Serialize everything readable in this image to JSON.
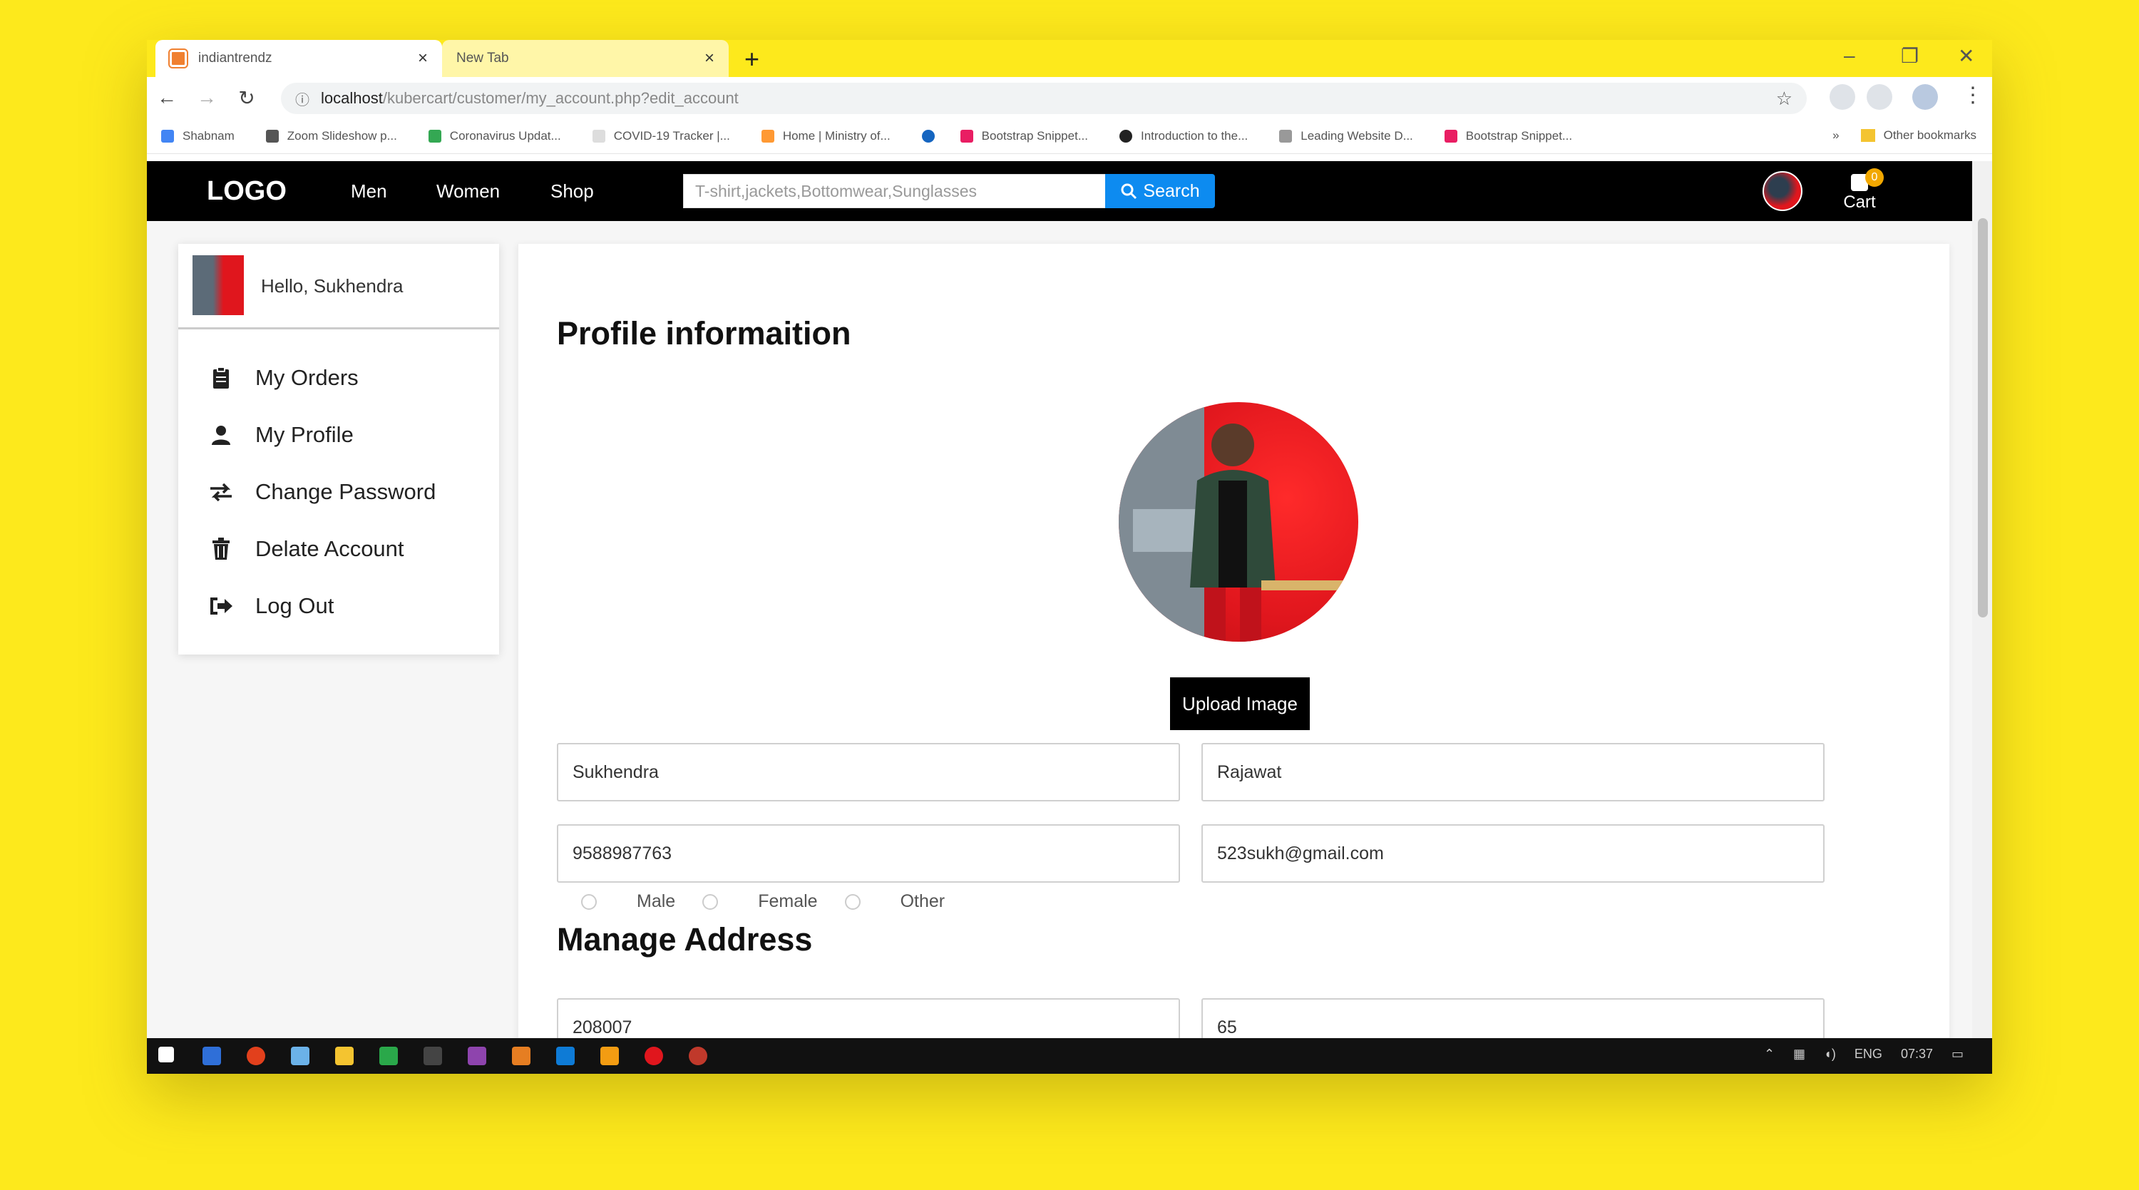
{
  "browser": {
    "tabs": [
      {
        "title": "indiantrendz",
        "active": true
      },
      {
        "title": "New Tab",
        "active": false
      }
    ],
    "new_tab_symbol": "+",
    "window_controls": [
      "–",
      "❐",
      "✕"
    ],
    "url_host": "localhost",
    "url_path": "/kubercart/customer/my_account.php?edit_account",
    "bookmarks": [
      {
        "label": "Shabnam",
        "color": "#4285f4"
      },
      {
        "label": "Zoom Slideshow p...",
        "color": "#555555"
      },
      {
        "label": "Coronavirus Updat...",
        "color": "#34a853"
      },
      {
        "label": "COVID-19 Tracker |...",
        "color": "#dddddd"
      },
      {
        "label": "Home | Ministry of...",
        "color": "#ff9933"
      },
      {
        "label": "",
        "color": "#1565c0"
      },
      {
        "label": "Bootstrap Snippet...",
        "color": "#e91e63"
      },
      {
        "label": "Introduction to the...",
        "color": "#222222"
      },
      {
        "label": "Leading Website D...",
        "color": "#999999"
      },
      {
        "label": "Bootstrap Snippet...",
        "color": "#e91e63"
      }
    ],
    "other_bookmarks": "Other bookmarks"
  },
  "site": {
    "logo": "LOGO",
    "nav": [
      "Men",
      "Women",
      "Shop"
    ],
    "search_placeholder": "T-shirt,jackets,Bottomwear,Sunglasses",
    "search_button": "Search",
    "cart_label": "Cart",
    "cart_count": "0"
  },
  "sidebar": {
    "greeting": "Hello, Sukhendra",
    "items": [
      {
        "label": "My Orders",
        "icon": "clipboard-icon"
      },
      {
        "label": "My Profile",
        "icon": "user-icon"
      },
      {
        "label": "Change Password",
        "icon": "exchange-icon"
      },
      {
        "label": "Delate Account",
        "icon": "trash-icon"
      },
      {
        "label": "Log Out",
        "icon": "sign-out-icon"
      }
    ]
  },
  "profile": {
    "heading": "Profile informaition",
    "upload_button": "Upload Image",
    "first_name": "Sukhendra",
    "last_name": "Rajawat",
    "phone": "9588987763",
    "email": "523sukh@gmail.com",
    "gender_options": [
      "Male",
      "Female",
      "Other"
    ]
  },
  "address": {
    "heading": "Manage Address",
    "field1": "208007",
    "field2": "65"
  },
  "taskbar": {
    "tray": [
      "ENG",
      "07:37"
    ]
  },
  "colors": {
    "background": "#fde91c",
    "navbar": "#000000",
    "search_button": "#0d8bf0",
    "accent_red": "#e0161d"
  }
}
